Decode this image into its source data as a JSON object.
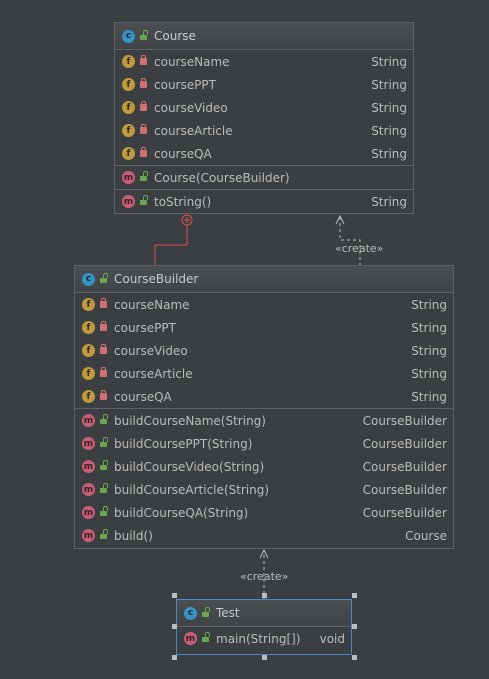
{
  "colors": {
    "background": "#3c3f41",
    "border": "#5f6264",
    "text": "#bbbbbb",
    "class_badge": "#3592c4",
    "field_badge": "#c29a3c",
    "method_badge": "#c75e79",
    "private_lock": "#d07070",
    "public_lock": "#6aa84f",
    "inner_class_connector": "#d9534f"
  },
  "course": {
    "name": "Course",
    "fields": [
      {
        "name": "courseName",
        "type": "String"
      },
      {
        "name": "coursePPT",
        "type": "String"
      },
      {
        "name": "courseVideo",
        "type": "String"
      },
      {
        "name": "courseArticle",
        "type": "String"
      },
      {
        "name": "courseQA",
        "type": "String"
      }
    ],
    "constructors": [
      {
        "name": "Course(CourseBuilder)",
        "type": ""
      }
    ],
    "methods": [
      {
        "name": "toString()",
        "type": "String"
      }
    ]
  },
  "builder": {
    "name": "CourseBuilder",
    "fields": [
      {
        "name": "courseName",
        "type": "String"
      },
      {
        "name": "coursePPT",
        "type": "String"
      },
      {
        "name": "courseVideo",
        "type": "String"
      },
      {
        "name": "courseArticle",
        "type": "String"
      },
      {
        "name": "courseQA",
        "type": "String"
      }
    ],
    "methods": [
      {
        "name": "buildCourseName(String)",
        "type": "CourseBuilder"
      },
      {
        "name": "buildCoursePPT(String)",
        "type": "CourseBuilder"
      },
      {
        "name": "buildCourseVideo(String)",
        "type": "CourseBuilder"
      },
      {
        "name": "buildCourseArticle(String)",
        "type": "CourseBuilder"
      },
      {
        "name": "buildCourseQA(String)",
        "type": "CourseBuilder"
      },
      {
        "name": "build()",
        "type": "Course"
      }
    ]
  },
  "test": {
    "name": "Test",
    "methods": [
      {
        "name": "main(String[])",
        "type": "void"
      }
    ]
  },
  "edges": {
    "create_label_1": "«create»",
    "create_label_2": "«create»"
  },
  "badges": {
    "class": "c",
    "field": "f",
    "method": "m"
  }
}
